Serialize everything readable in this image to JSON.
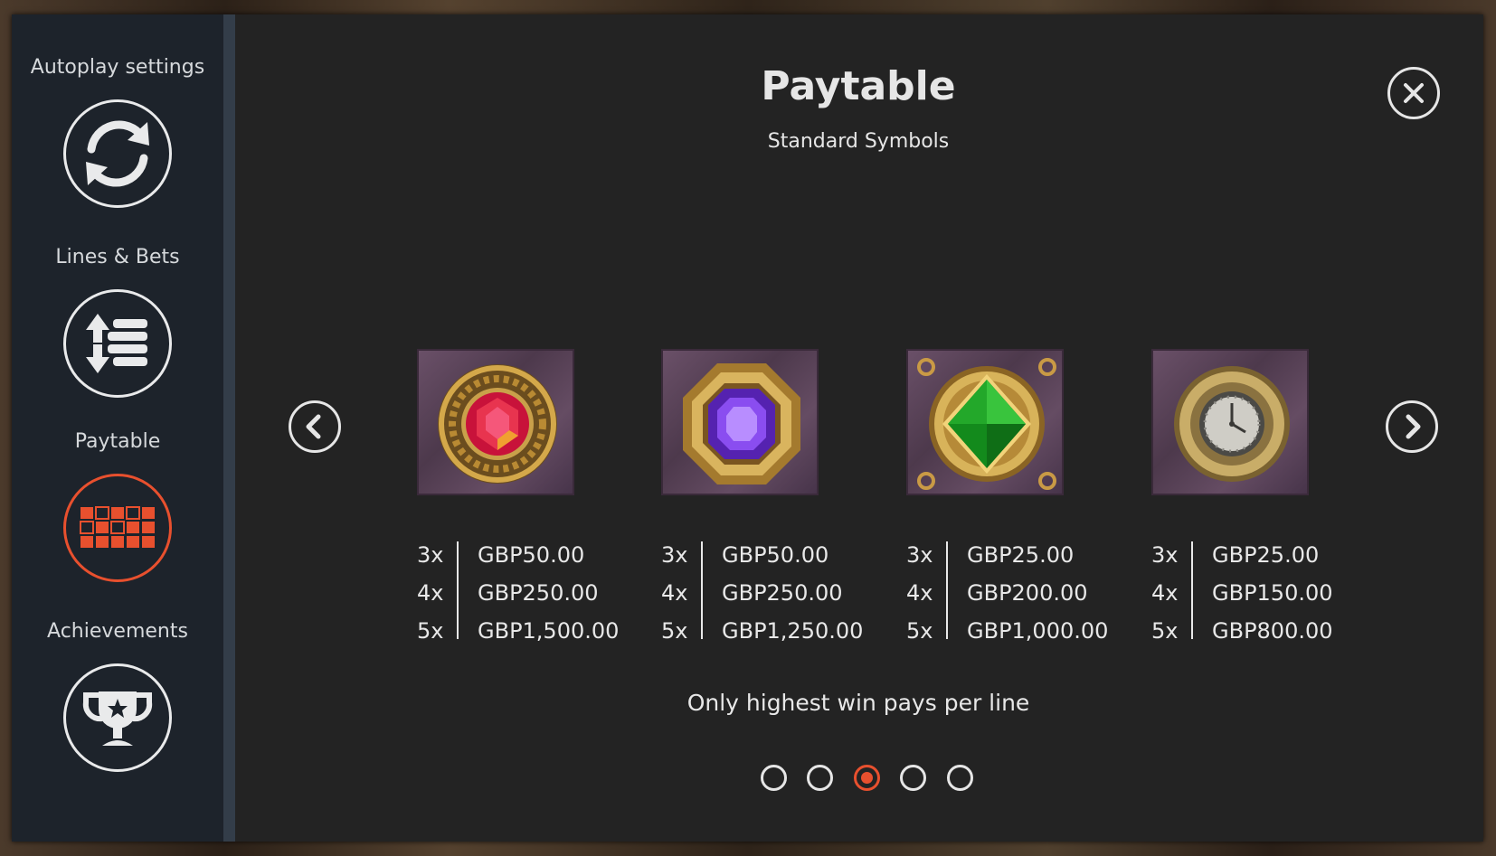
{
  "sidebar": {
    "items": [
      {
        "label": "Autoplay settings",
        "icon": "refresh-icon",
        "active": false
      },
      {
        "label": "Lines & Bets",
        "icon": "lines-bets-icon",
        "active": false
      },
      {
        "label": "Paytable",
        "icon": "paytable-grid-icon",
        "active": true
      },
      {
        "label": "Achievements",
        "icon": "trophy-icon",
        "active": false
      }
    ]
  },
  "header": {
    "title": "Paytable",
    "subtitle": "Standard Symbols"
  },
  "symbols": [
    {
      "name": "red-gem-symbol",
      "pays": [
        {
          "mult": "3x",
          "value": "GBP50.00"
        },
        {
          "mult": "4x",
          "value": "GBP250.00"
        },
        {
          "mult": "5x",
          "value": "GBP1,500.00"
        }
      ]
    },
    {
      "name": "purple-gem-symbol",
      "pays": [
        {
          "mult": "3x",
          "value": "GBP50.00"
        },
        {
          "mult": "4x",
          "value": "GBP250.00"
        },
        {
          "mult": "5x",
          "value": "GBP1,250.00"
        }
      ]
    },
    {
      "name": "green-gem-symbol",
      "pays": [
        {
          "mult": "3x",
          "value": "GBP25.00"
        },
        {
          "mult": "4x",
          "value": "GBP200.00"
        },
        {
          "mult": "5x",
          "value": "GBP1,000.00"
        }
      ]
    },
    {
      "name": "clock-symbol",
      "pays": [
        {
          "mult": "3x",
          "value": "GBP25.00"
        },
        {
          "mult": "4x",
          "value": "GBP150.00"
        },
        {
          "mult": "5x",
          "value": "GBP800.00"
        }
      ]
    }
  ],
  "footnote": "Only highest win pays per line",
  "pagination": {
    "pages": 5,
    "current": 3
  },
  "colors": {
    "accent": "#e8502e",
    "panel": "#232323",
    "sidebar": "#1d232b"
  }
}
